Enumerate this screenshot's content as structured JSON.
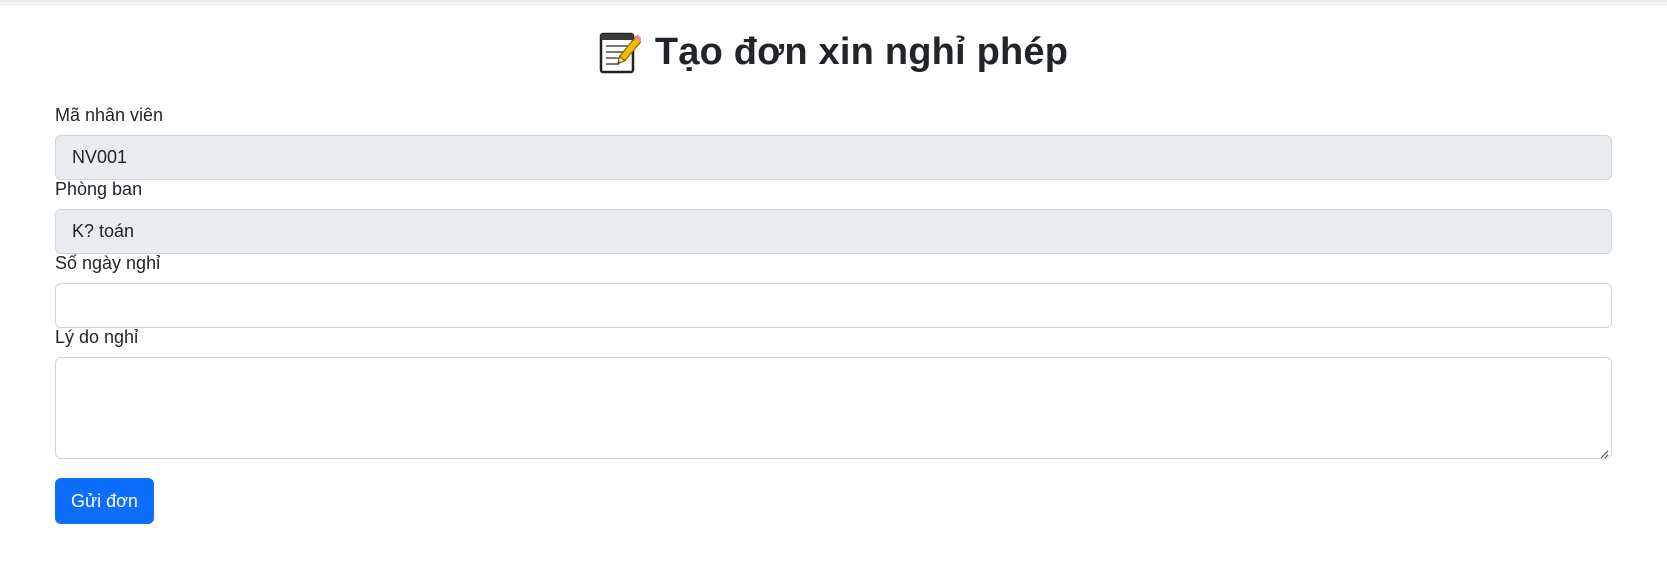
{
  "title": {
    "icon": "memo-icon",
    "text": "Tạo đơn xin nghỉ phép"
  },
  "form": {
    "employee_id": {
      "label": "Mã nhân viên",
      "value": "NV001",
      "readonly": true
    },
    "department": {
      "label": "Phòng ban",
      "value": "K? toán",
      "readonly": true
    },
    "days": {
      "label": "Số ngày nghỉ",
      "value": ""
    },
    "reason": {
      "label": "Lý do nghỉ",
      "value": ""
    },
    "submit_label": "Gửi đơn"
  },
  "colors": {
    "primary": "#0d6efd",
    "readonly_bg": "#e9ecef",
    "border": "#ced4da",
    "text": "#212529"
  }
}
